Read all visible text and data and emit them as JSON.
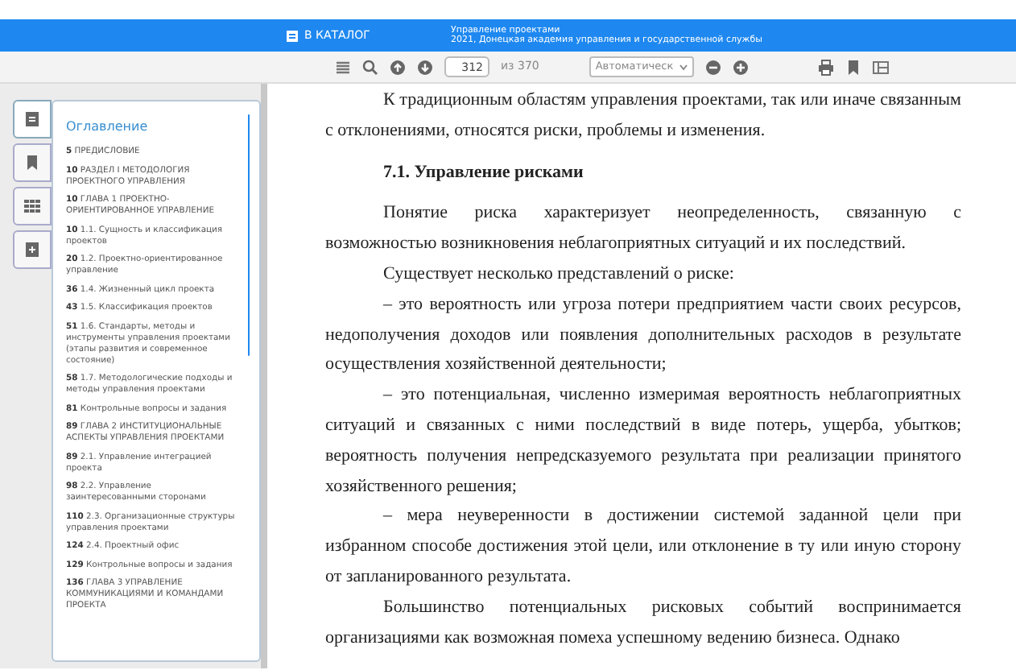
{
  "header": {
    "catalog_link": "В КАТАЛОГ",
    "book_title": "Управление проектами",
    "book_source": "2021, Донецкая академия управления и государственной службы"
  },
  "toolbar": {
    "page": "312",
    "page_total": "из 370",
    "zoom": "Автоматическ"
  },
  "side_tabs": [
    {
      "kind": "outline",
      "selected": true
    },
    {
      "kind": "bookmarks",
      "selected": false
    },
    {
      "kind": "thumbnails",
      "selected": false
    },
    {
      "kind": "attachments",
      "selected": false
    }
  ],
  "outline": {
    "title": "Оглавление",
    "items": [
      {
        "page": "5",
        "title": "ПРЕДИСЛОВИЕ"
      },
      {
        "page": "10",
        "title": "РАЗДЕЛ I МЕТОДОЛОГИЯ ПРОЕКТНОГО УПРАВЛЕНИЯ"
      },
      {
        "page": "10",
        "title": "ГЛАВА 1 ПРОЕКТНО-ОРИЕНТИРОВАННОЕ УПРАВЛЕНИЕ"
      },
      {
        "page": "10",
        "title": "1.1. Сущность и классификация проектов"
      },
      {
        "page": "20",
        "title": "1.2. Проектно-ориентированное управление"
      },
      {
        "page": "36",
        "title": "1.4. Жизненный цикл проекта"
      },
      {
        "page": "43",
        "title": "1.5. Классификация проектов"
      },
      {
        "page": "51",
        "title": "1.6. Стандарты, методы и инструменты управления проектами (этапы развития и современное состояние)"
      },
      {
        "page": "58",
        "title": "1.7. Методологические подходы и методы управления проектами"
      },
      {
        "page": "81",
        "title": "Контрольные вопросы и задания"
      },
      {
        "page": "89",
        "title": "ГЛАВА 2 ИНСТИТУЦИОНАЛЬНЫЕ АСПЕКТЫ УПРАВЛЕНИЯ ПРОЕКТАМИ"
      },
      {
        "page": "89",
        "title": "2.1. Управление интеграцией проекта"
      },
      {
        "page": "98",
        "title": "2.2. Управление заинтересованными сторонами"
      },
      {
        "page": "110",
        "title": "2.3. Организационные структуры управления проектами"
      },
      {
        "page": "124",
        "title": "2.4. Проектный офис"
      },
      {
        "page": "129",
        "title": "Контрольные вопросы и задания"
      },
      {
        "page": "136",
        "title": "ГЛАВА 3 УПРАВЛЕНИЕ КОММУНИКАЦИЯМИ И КОМАНДАМИ ПРОЕКТА"
      }
    ]
  },
  "document": [
    {
      "kind": "paragraph",
      "text": "К традиционным областям управления проектами, так или иначе связанным с отклонениями, относятся риски, проблемы и изменения."
    },
    {
      "kind": "heading",
      "text": "7.1. Управление рисками"
    },
    {
      "kind": "paragraph",
      "text": "Понятие риска характеризует неопределенность, связанную с возможностью возникновения неблагоприятных ситуаций и их последствий."
    },
    {
      "kind": "paragraph",
      "text": "Существует несколько представлений о риске:"
    },
    {
      "kind": "paragraph",
      "text": "– это вероятность или угроза потери предприятием части своих ресурсов, недополучения доходов или появления дополнительных расходов в результате осуществления хозяйственной деятельности;"
    },
    {
      "kind": "paragraph",
      "text": "– это потенциальная, численно измеримая вероятность неблагоприятных ситуаций и связанных с ними последствий в виде потерь, ущерба, убытков; вероятность получения непредсказуемого результата при реализации принятого хозяйственного решения;"
    },
    {
      "kind": "paragraph",
      "text": "– мера неуверенности в достижении системой заданной цели при избранном способе достижения этой цели, или отклонение в ту или иную сторону от запланированного результата."
    },
    {
      "kind": "paragraph",
      "text": "Большинство потенциальных рисковых событий воспринимается организациями как возможная помеха успешному ведению бизнеса. Однако"
    }
  ]
}
